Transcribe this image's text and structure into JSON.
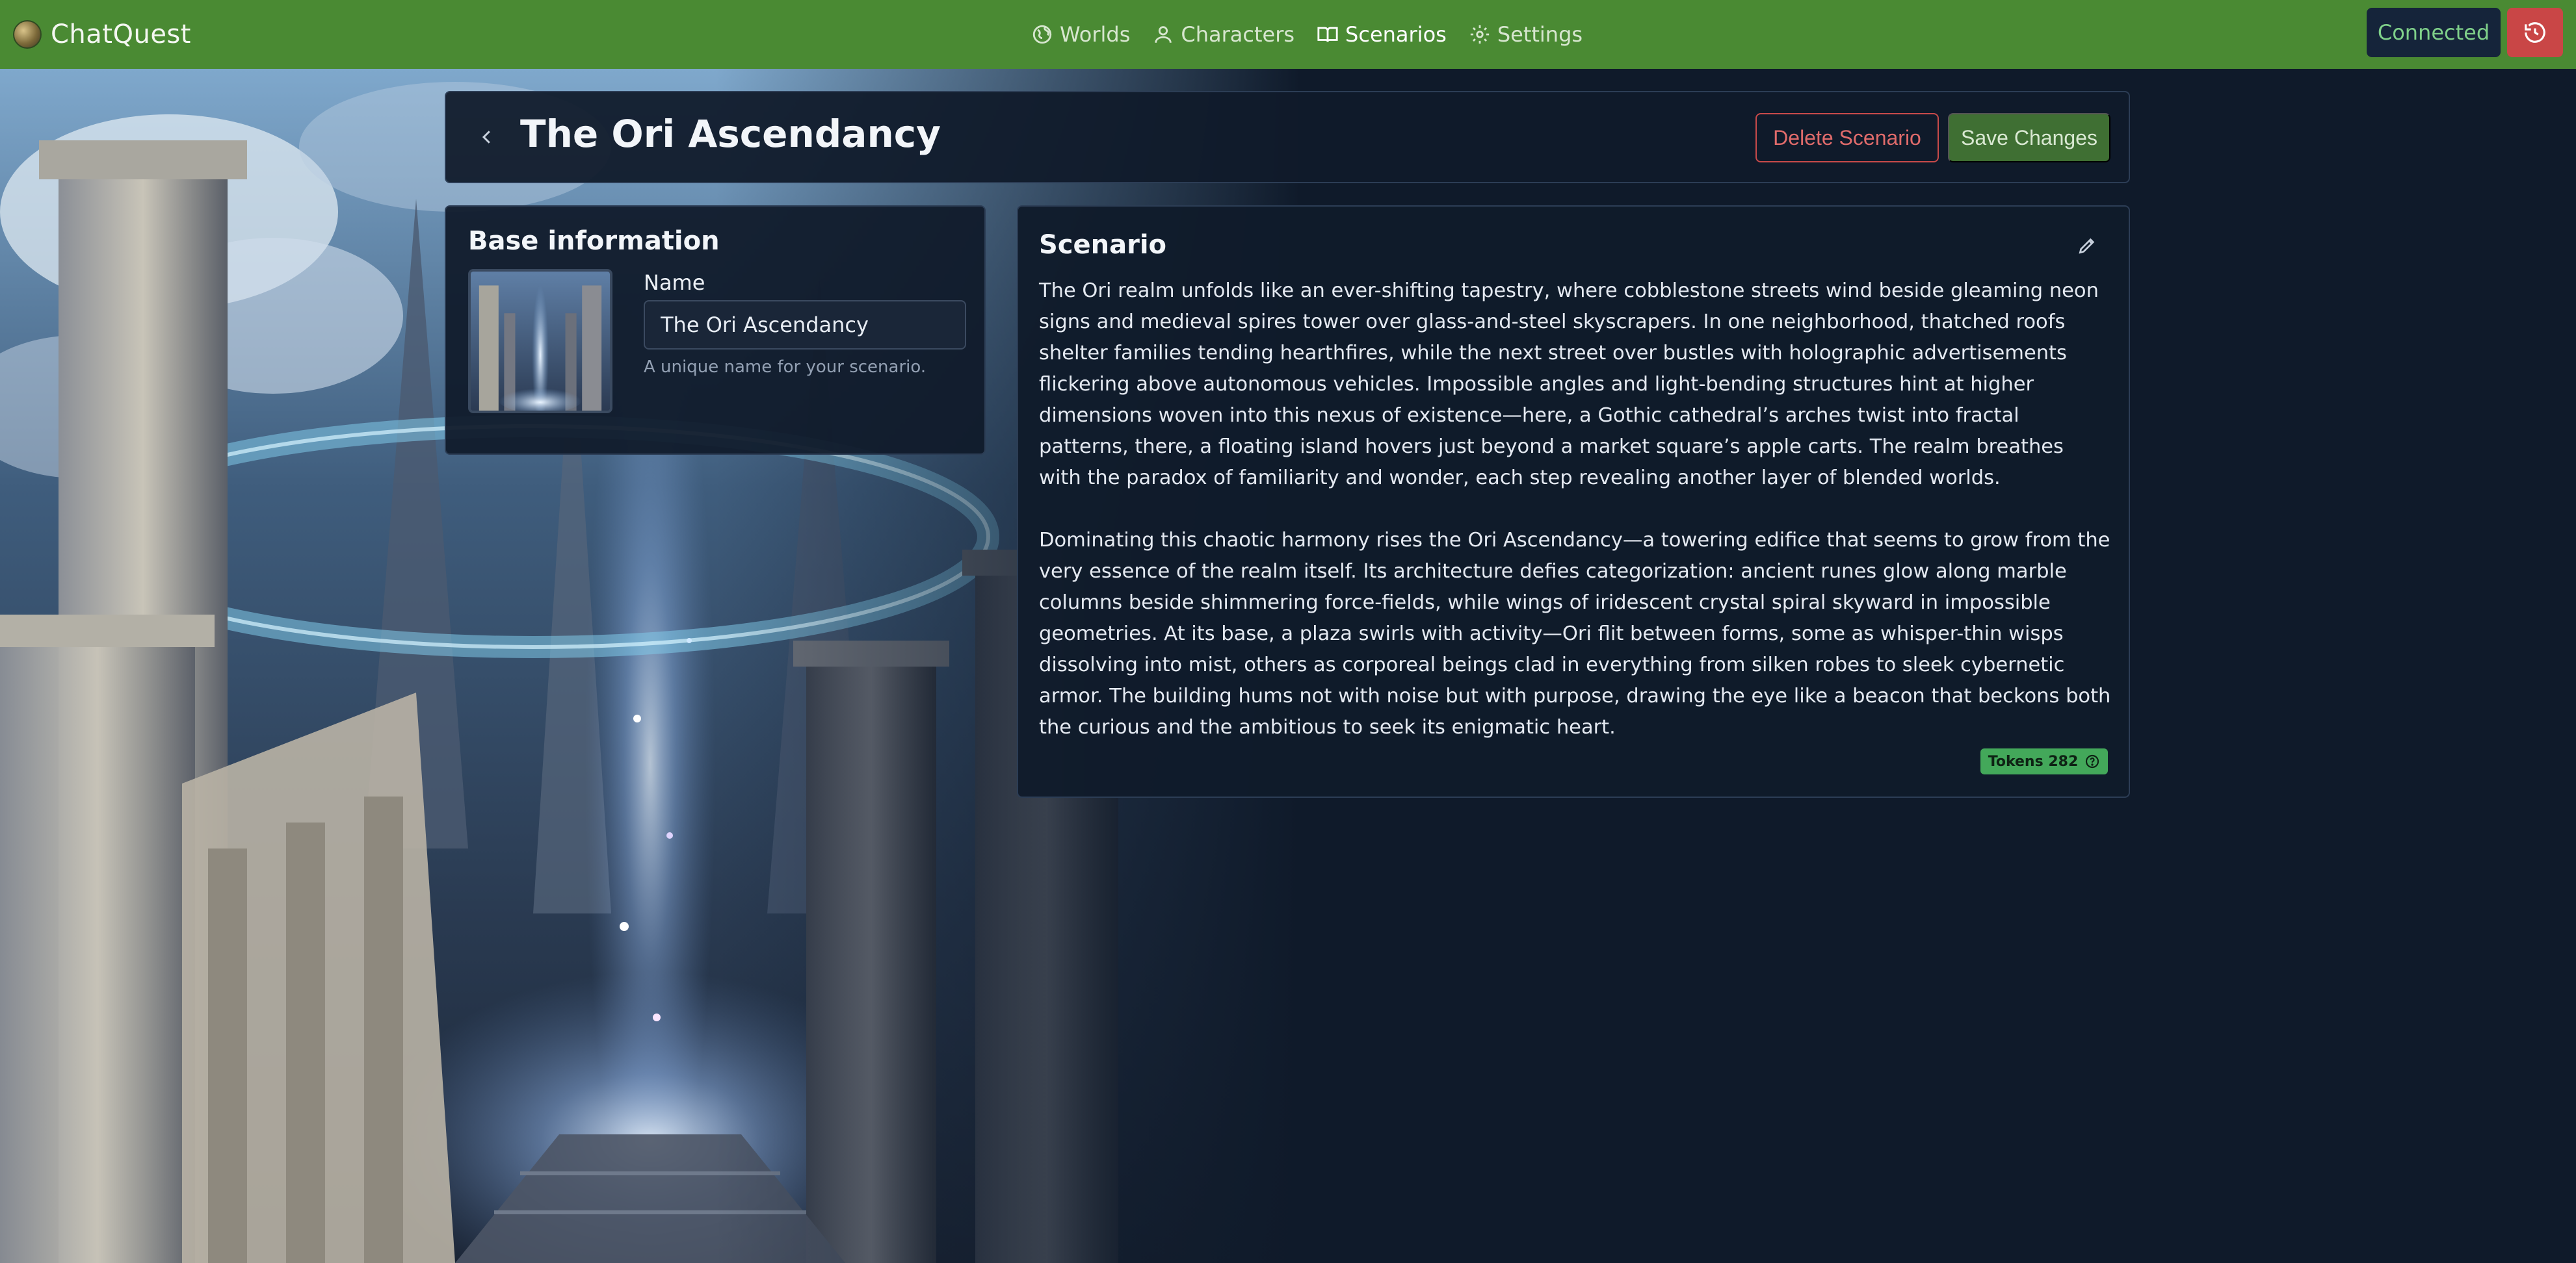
{
  "app": {
    "brand_name": "ChatQuest",
    "logo_icon": "chatquest-logo-icon"
  },
  "nav": {
    "items": [
      {
        "label": "Worlds",
        "icon": "globe-icon",
        "active": false
      },
      {
        "label": "Characters",
        "icon": "user-icon",
        "active": false
      },
      {
        "label": "Scenarios",
        "icon": "book-icon",
        "active": true
      },
      {
        "label": "Settings",
        "icon": "gear-icon",
        "active": false
      }
    ]
  },
  "status": {
    "connection_label": "Connected",
    "reset_icon": "history-reset-icon"
  },
  "header": {
    "back_icon": "chevron-left-icon",
    "title": "The Ori Ascendancy",
    "delete_label": "Delete Scenario",
    "save_label": "Save Changes"
  },
  "base_info": {
    "title": "Base information",
    "name_label": "Name",
    "name_value": "The Ori Ascendancy",
    "name_help": "A unique name for your scenario."
  },
  "scenario": {
    "title": "Scenario",
    "edit_icon": "pencil-icon",
    "paragraphs": [
      "The Ori realm unfolds like an ever-shifting tapestry, where cobblestone streets wind beside gleaming neon signs and medieval spires tower over glass-and-steel skyscrapers. In one neighborhood, thatched roofs shelter families tending hearthfires, while the next street over bustles with holographic advertisements flickering above autonomous vehicles. Impossible angles and light-bending structures hint at higher dimensions woven into this nexus of existence—here, a Gothic cathedral’s arches twist into fractal patterns, there, a floating island hovers just beyond a market square’s apple carts. The realm breathes with the paradox of familiarity and wonder, each step revealing another layer of blended worlds.",
      "Dominating this chaotic harmony rises the Ori Ascendancy—a towering edifice that seems to grow from the very essence of the realm itself. Its architecture defies categorization: ancient runes glow along marble columns beside shimmering force-fields, while wings of iridescent crystal spiral skyward in impossible geometries. At its base, a plaza swirls with activity—Ori flit between forms, some as whisper-thin wisps dissolving into mist, others as corporeal beings clad in everything from silken robes to sleek cybernetic armor. The building hums not with noise but with purpose, drawing the eye like a beacon that beckons both the curious and the ambitious to seek its enigmatic heart."
    ],
    "tokens_label": "Tokens 282",
    "tokens_help_icon": "help-circle-icon"
  },
  "colors": {
    "topbar": "#4a8a33",
    "page_background": "#0f1a2a",
    "connected_text": "#7fd08a",
    "danger": "#c94646",
    "save": "#3f6f33",
    "tokens_badge": "#43a85a"
  }
}
